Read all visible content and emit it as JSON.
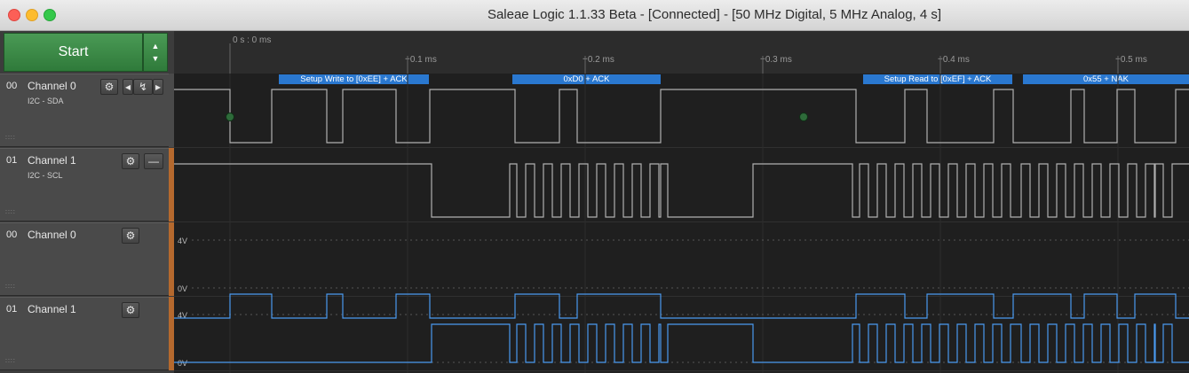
{
  "window": {
    "title": "Saleae Logic 1.1.33 Beta - [Connected] - [50 MHz Digital, 5 MHz Analog, 4 s]"
  },
  "controls": {
    "start_label": "Start",
    "up_glyph": "▲",
    "down_glyph": "▼"
  },
  "ruler": {
    "origin_label": "0 s : 0 ms",
    "ticks": [
      "+0.1 ms",
      "+0.2 ms",
      "+0.3 ms",
      "+0.4 ms",
      "+0.5 ms"
    ]
  },
  "channels": [
    {
      "num": "00",
      "name": "Channel 0",
      "sub": "I2C - SDA",
      "type": "digital",
      "color": "#b0b0b0"
    },
    {
      "num": "01",
      "name": "Channel 1",
      "sub": "I2C - SCL",
      "type": "digital",
      "color": "#b0b0b0"
    },
    {
      "num": "00",
      "name": "Channel 0",
      "sub": "",
      "type": "analog",
      "color": "#4a9af0"
    },
    {
      "num": "01",
      "name": "Channel 1",
      "sub": "",
      "type": "analog",
      "color": "#4a9af0"
    }
  ],
  "icons": {
    "gear": "⚙",
    "prev": "◂",
    "edge": "↯",
    "next": "▸",
    "minus": "—",
    "grip": "::::"
  },
  "analog_scale": {
    "high": "4V",
    "low": "0V"
  },
  "annotations": [
    "Setup Write to [0xEE] + ACK",
    "0xD0 + ACK",
    "Setup Read to [0xEF] + ACK",
    "0x55 + NAK"
  ],
  "colors": {
    "start_green": "#3a8a45",
    "annotation_blue": "#2a78d0",
    "analog_trace": "#4a9af0",
    "digital_trace": "#b0b0b0",
    "marker_green": "#2e6b3a",
    "active_stripe": "#b5692e"
  }
}
